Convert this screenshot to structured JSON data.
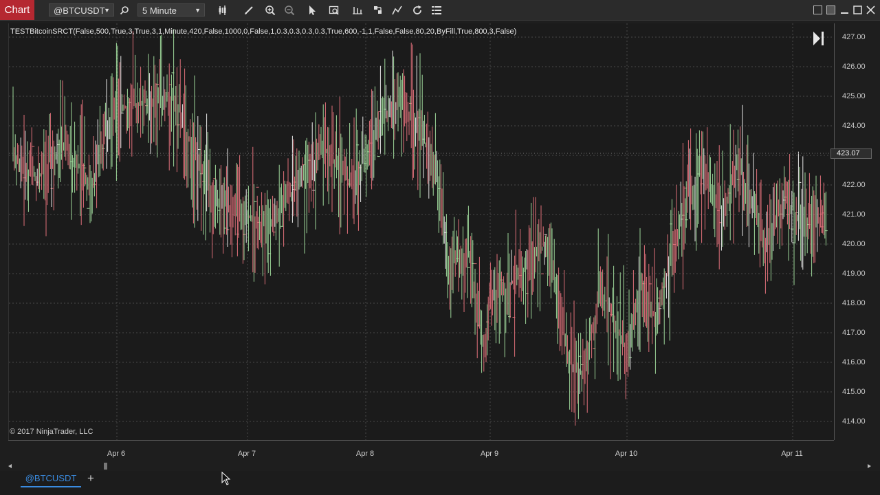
{
  "toolbar": {
    "chart_tab_label": "Chart",
    "instrument": "@BTCUSDT",
    "interval": "5 Minute",
    "icons": [
      "search-icon",
      "bar-type-icon",
      "pencil-icon",
      "zoom-in-icon",
      "zoom-out-icon",
      "pointer-icon",
      "data-box-icon",
      "properties-icon",
      "strategies-icon",
      "indicators-icon",
      "reload-icon",
      "list-icon"
    ]
  },
  "chart": {
    "indicator_label": "TESTBitcoinSRCT(False,500,True,3,True,3,1,Minute,420,False,1000,0,False,1,0.3,0.3,0.3,0.3,True,600,-1,1,False,False,80,20,ByFill,True,800,3,False)",
    "copyright": "© 2017 NinjaTrader, LLC",
    "last_price": "423.07",
    "price_axis_labels": [
      "427.00",
      "426.00",
      "425.00",
      "424.00",
      "423.00",
      "422.00",
      "421.00",
      "420.00",
      "419.00",
      "418.00",
      "417.00",
      "416.00",
      "415.00",
      "414.00"
    ],
    "date_labels": [
      "Apr 6",
      "Apr 7",
      "Apr 8",
      "Apr 9",
      "Apr 10",
      "Apr 11"
    ],
    "colors": {
      "up": "#9ed79a",
      "down": "#e0707a",
      "neutral": "#e8e8e8",
      "grid": "#4a4a4a",
      "accent": "#b52831"
    }
  },
  "bottom": {
    "instrument_tab": "@BTCUSDT",
    "add_tab": "+"
  }
}
